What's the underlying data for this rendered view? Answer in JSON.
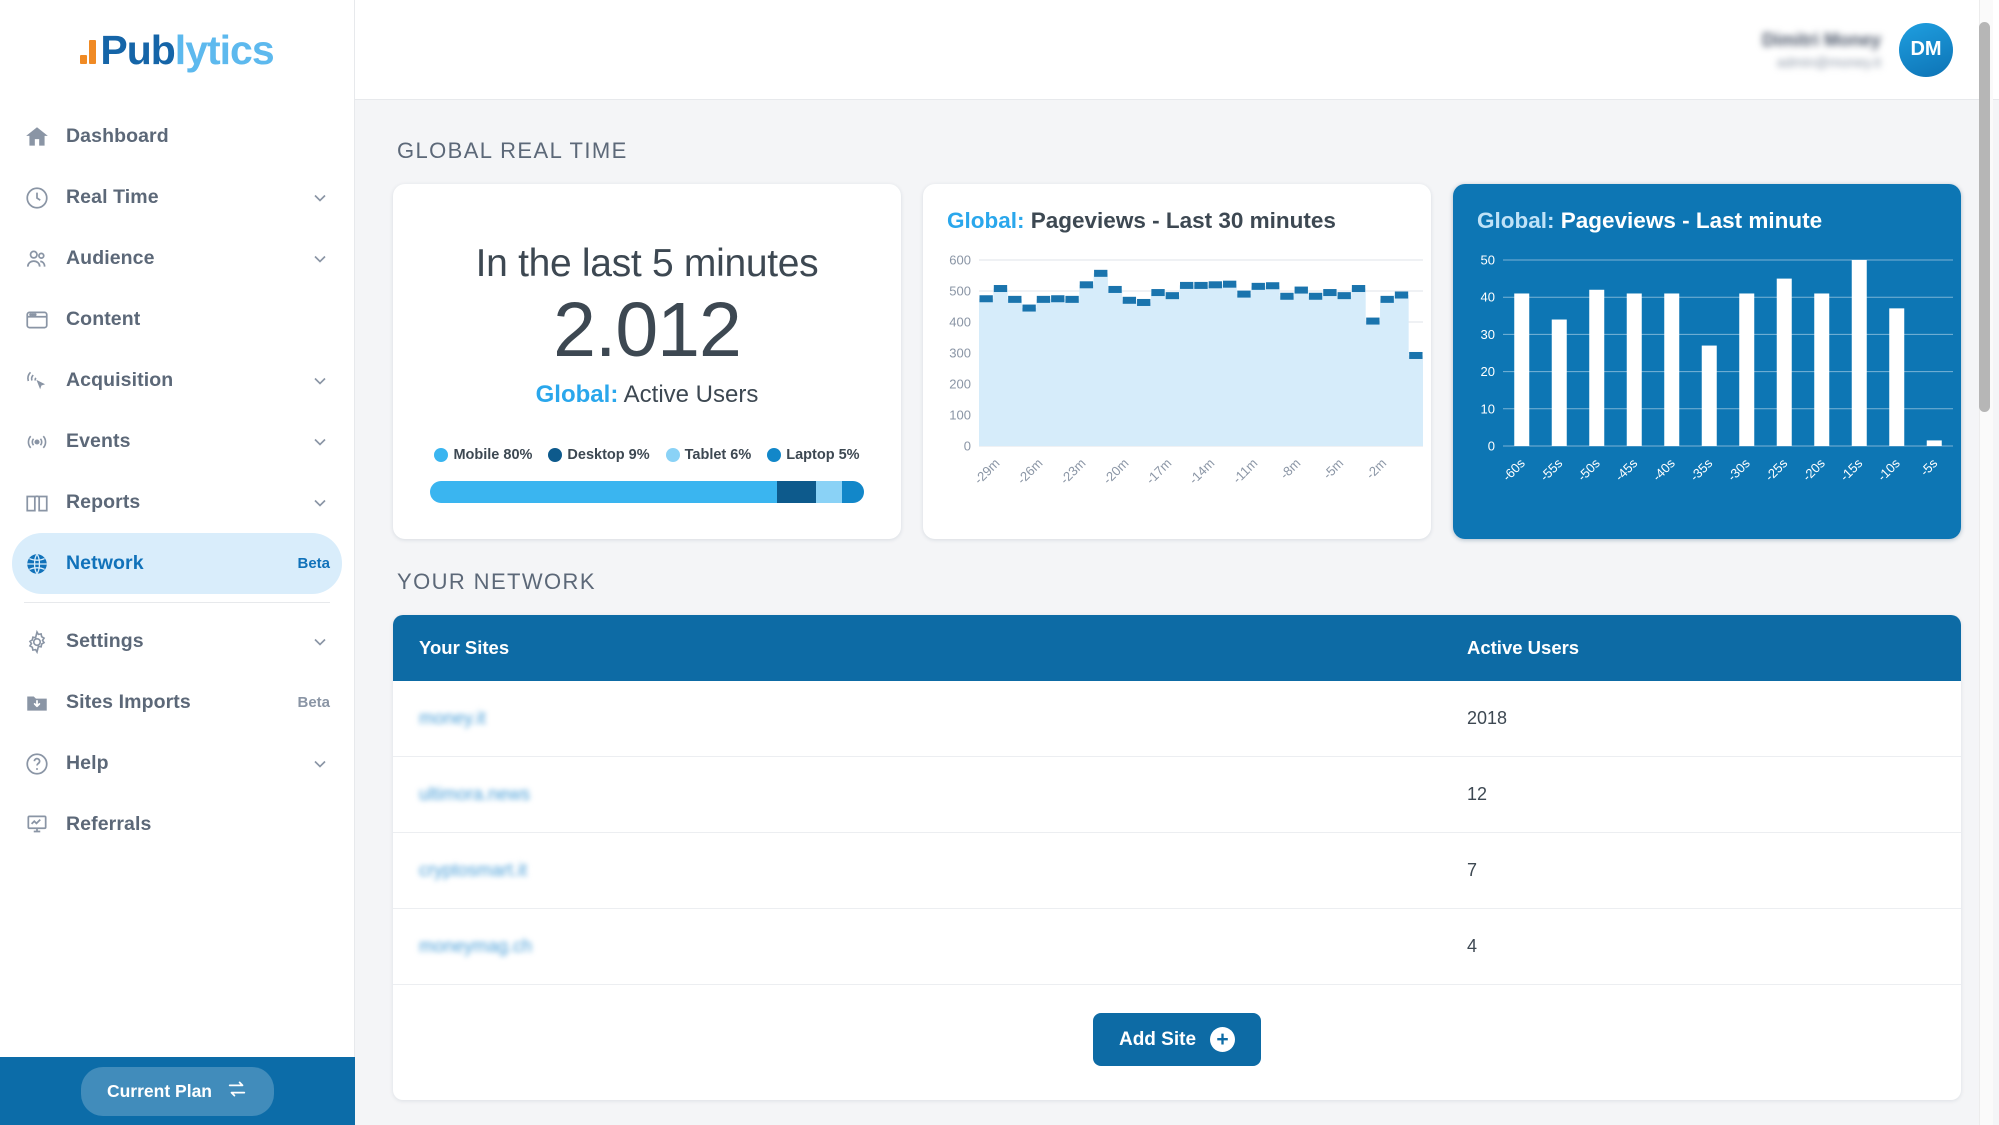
{
  "brand": {
    "logo_prefix": "Pub",
    "logo_suffix": "lytics"
  },
  "sidebar": {
    "items": [
      {
        "label": "Dashboard",
        "icon": "home-icon",
        "chevron": false,
        "badge": ""
      },
      {
        "label": "Real Time",
        "icon": "clock-icon",
        "chevron": true,
        "badge": ""
      },
      {
        "label": "Audience",
        "icon": "users-icon",
        "chevron": true,
        "badge": ""
      },
      {
        "label": "Content",
        "icon": "browser-icon",
        "chevron": false,
        "badge": ""
      },
      {
        "label": "Acquisition",
        "icon": "cursor-click-icon",
        "chevron": true,
        "badge": ""
      },
      {
        "label": "Events",
        "icon": "broadcast-icon",
        "chevron": true,
        "badge": ""
      },
      {
        "label": "Reports",
        "icon": "book-icon",
        "chevron": true,
        "badge": ""
      },
      {
        "label": "Network",
        "icon": "globe-icon",
        "chevron": false,
        "badge": "Beta",
        "active": true
      },
      {
        "label": "Settings",
        "icon": "gear-icon",
        "chevron": true,
        "badge": ""
      },
      {
        "label": "Sites Imports",
        "icon": "folder-download-icon",
        "chevron": false,
        "badge": "Beta"
      },
      {
        "label": "Help",
        "icon": "question-circle-icon",
        "chevron": true,
        "badge": ""
      },
      {
        "label": "Referrals",
        "icon": "presentation-chart-icon",
        "chevron": false,
        "badge": ""
      }
    ],
    "plan_button": "Current Plan"
  },
  "topbar": {
    "user_name": "Dimitri Money",
    "user_email": "admin@money.it",
    "avatar_initials": "DM"
  },
  "sections": {
    "global_real_time": "GLOBAL REAL TIME",
    "your_network": "YOUR NETWORK"
  },
  "active_users_card": {
    "headline": "In the last 5 minutes",
    "value": "2.012",
    "sub_prefix": "Global:",
    "sub_label": "Active Users",
    "devices": [
      {
        "label": "Mobile 80%",
        "pct": 80,
        "color": "#3ab5f0"
      },
      {
        "label": "Desktop 9%",
        "pct": 9,
        "color": "#0d5a8c"
      },
      {
        "label": "Tablet 6%",
        "pct": 6,
        "color": "#8ad2f6"
      },
      {
        "label": "Laptop 5%",
        "pct": 5,
        "color": "#1287c9"
      }
    ]
  },
  "chart_data": [
    {
      "type": "area",
      "id": "pageviews-30min",
      "title": "Global: Pageviews - Last 30 minutes",
      "title_prefix": "Global:",
      "title_rest": "Pageviews - Last 30 minutes",
      "xlabel": "",
      "ylabel": "",
      "ylim": [
        0,
        600
      ],
      "yticks": [
        0,
        100,
        200,
        300,
        400,
        500,
        600
      ],
      "grid": true,
      "legend": "none",
      "step": true,
      "line_color": "#1a74ad",
      "fill_color": "#d6ecfa",
      "xtick_labels": [
        "-29m",
        "-26m",
        "-23m",
        "-20m",
        "-17m",
        "-14m",
        "-11m",
        "-8m",
        "-5m",
        "-2m"
      ],
      "x": [
        "-30m",
        "-29m",
        "-28m",
        "-27m",
        "-26m",
        "-25m",
        "-24m",
        "-23m",
        "-22m",
        "-21m",
        "-20m",
        "-19m",
        "-18m",
        "-17m",
        "-16m",
        "-15m",
        "-14m",
        "-13m",
        "-12m",
        "-11m",
        "-10m",
        "-9m",
        "-8m",
        "-7m",
        "-6m",
        "-5m",
        "-4m",
        "-3m",
        "-2m",
        "-1m"
      ],
      "values": [
        475,
        508,
        473,
        445,
        473,
        475,
        473,
        520,
        557,
        505,
        470,
        463,
        495,
        485,
        518,
        518,
        520,
        522,
        490,
        515,
        517,
        483,
        503,
        483,
        495,
        485,
        508,
        403,
        473,
        487,
        292
      ]
    },
    {
      "type": "bar",
      "id": "pageviews-last-minute",
      "title": "Global: Pageviews - Last minute",
      "title_prefix": "Global:",
      "title_rest": "Pageviews - Last minute",
      "xlabel": "",
      "ylabel": "",
      "ylim": [
        0,
        50
      ],
      "yticks": [
        0,
        10,
        20,
        30,
        40,
        50
      ],
      "grid": true,
      "legend": "none",
      "bar_color": "#ffffff",
      "background": "#0d76b4",
      "categories": [
        "-60s",
        "-55s",
        "-50s",
        "-45s",
        "-40s",
        "-35s",
        "-30s",
        "-25s",
        "-20s",
        "-15s",
        "-10s",
        "-5s"
      ],
      "values": [
        41,
        34,
        42,
        41,
        41,
        27,
        41,
        45,
        41,
        50,
        37,
        1.5
      ]
    }
  ],
  "network_table": {
    "columns": [
      "Your Sites",
      "Active Users"
    ],
    "rows": [
      {
        "site": "money.it",
        "active_users": "2018"
      },
      {
        "site": "ultimora.news",
        "active_users": "12"
      },
      {
        "site": "cryptosmart.it",
        "active_users": "7"
      },
      {
        "site": "moneymag.ch",
        "active_users": "4"
      }
    ],
    "add_button": "Add Site"
  },
  "colors": {
    "accent_blue": "#0d6ba5",
    "light_blue": "#2aa7ec",
    "card_blue": "#0d76b4",
    "sidebar_active_bg": "#d9edfb"
  }
}
